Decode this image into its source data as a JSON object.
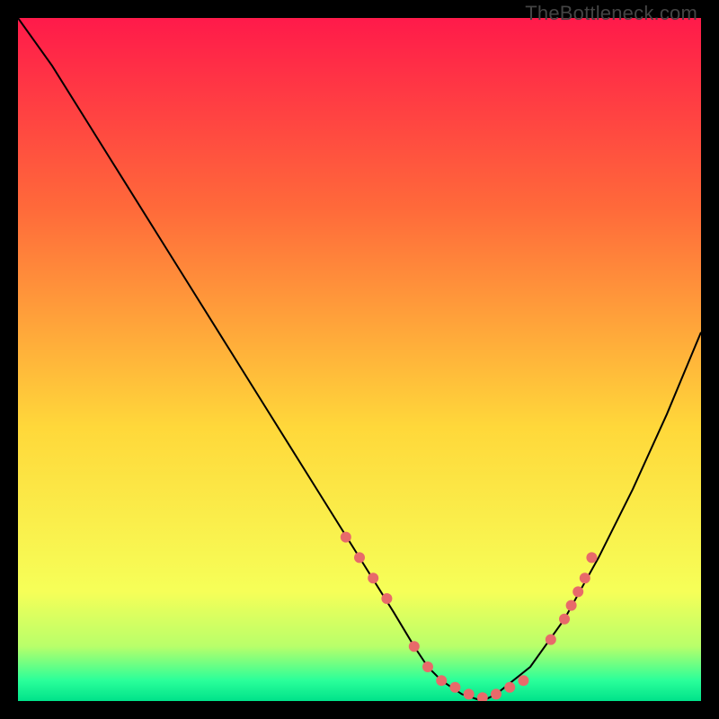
{
  "watermark": "TheBottleneck.com",
  "gradient_colors": {
    "top": "#ff1a4a",
    "mid1": "#ff6a3a",
    "mid2": "#ffd83a",
    "low": "#f6ff58",
    "tip1": "#b8ff6a",
    "tip2": "#2aff9a",
    "tip3": "#00e28a"
  },
  "chart_data": {
    "type": "line",
    "title": "",
    "xlabel": "",
    "ylabel": "",
    "xlim": [
      0,
      100
    ],
    "ylim": [
      0,
      100
    ],
    "note": "V-shaped bottleneck curve; y is mismatch/bottleneck %, 0 at optimum. Values estimated from pixel positions; no axis ticks shown.",
    "series": [
      {
        "name": "bottleneck-curve",
        "x": [
          0,
          5,
          10,
          15,
          20,
          25,
          30,
          35,
          40,
          45,
          50,
          55,
          58,
          60,
          62,
          65,
          68,
          70,
          75,
          80,
          85,
          90,
          95,
          100
        ],
        "y": [
          100,
          93,
          85,
          77,
          69,
          61,
          53,
          45,
          37,
          29,
          21,
          13,
          8,
          5,
          3,
          1,
          0,
          1,
          5,
          12,
          21,
          31,
          42,
          54
        ]
      }
    ],
    "markers": {
      "name": "highlight-dots",
      "color": "#e86a6a",
      "x": [
        48,
        50,
        52,
        54,
        58,
        60,
        62,
        64,
        66,
        68,
        70,
        72,
        74,
        78,
        80,
        81,
        82,
        83,
        84
      ],
      "y": [
        24,
        21,
        18,
        15,
        8,
        5,
        3,
        2,
        1,
        0.5,
        1,
        2,
        3,
        9,
        12,
        14,
        16,
        18,
        21
      ]
    }
  }
}
